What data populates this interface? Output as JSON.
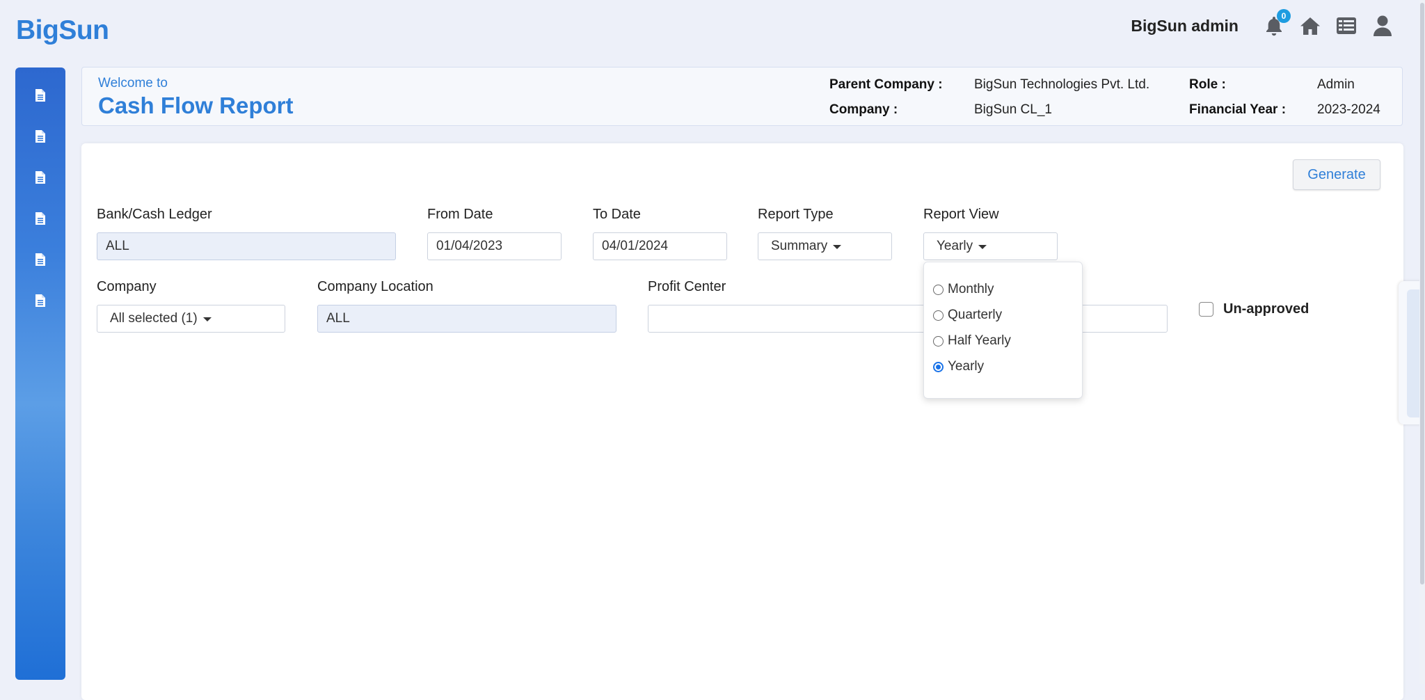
{
  "app": {
    "logo": "BigSun"
  },
  "topbar": {
    "user_name": "BigSun admin",
    "notification_count": "0",
    "icons": [
      "bell-icon",
      "home-icon",
      "list-icon",
      "user-icon"
    ]
  },
  "sidebar": {
    "items": [
      {
        "icon": "document-icon"
      },
      {
        "icon": "document-icon"
      },
      {
        "icon": "document-icon"
      },
      {
        "icon": "document-icon"
      },
      {
        "icon": "document-icon"
      },
      {
        "icon": "document-icon"
      }
    ]
  },
  "header": {
    "welcome": "Welcome to",
    "title": "Cash Flow Report",
    "parent_company_label": "Parent Company :",
    "parent_company_value": "BigSun Technologies Pvt. Ltd.",
    "company_label": "Company :",
    "company_value": "BigSun CL_1",
    "role_label": "Role :",
    "role_value": "Admin",
    "fy_label": "Financial Year :",
    "fy_value": "2023-2024"
  },
  "form": {
    "generate_label": "Generate",
    "ledger": {
      "label": "Bank/Cash Ledger",
      "value": "ALL"
    },
    "from_date": {
      "label": "From Date",
      "value": "01/04/2023"
    },
    "to_date": {
      "label": "To Date",
      "value": "04/01/2024"
    },
    "report_type": {
      "label": "Report Type",
      "value": "Summary"
    },
    "report_view": {
      "label": "Report View",
      "value": "Yearly",
      "options": [
        {
          "label": "Monthly",
          "checked": false
        },
        {
          "label": "Quarterly",
          "checked": false
        },
        {
          "label": "Half Yearly",
          "checked": false
        },
        {
          "label": "Yearly",
          "checked": true
        }
      ]
    },
    "company": {
      "label": "Company",
      "value": "All selected (1)"
    },
    "company_location": {
      "label": "Company Location",
      "value": "ALL"
    },
    "profit_center": {
      "label": "Profit Center",
      "value": ""
    },
    "unapproved": {
      "label": "Un-approved",
      "checked": false
    }
  },
  "colors": {
    "brand": "#2f7fd8",
    "badge": "#1e9ce0",
    "radio_selected": "#1a73e8"
  }
}
